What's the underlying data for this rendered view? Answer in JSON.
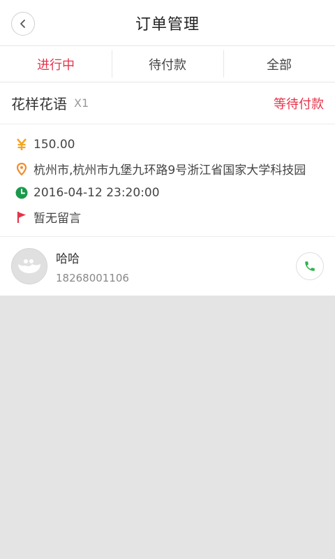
{
  "header": {
    "title": "订单管理"
  },
  "tabs": [
    {
      "label": "进行中",
      "active": true
    },
    {
      "label": "待付款",
      "active": false
    },
    {
      "label": "全部",
      "active": false
    }
  ],
  "order": {
    "product_name": "花样花语",
    "quantity": "X1",
    "status": "等待付款",
    "price": "150.00",
    "address": "杭州市,杭州市九堡九环路9号浙江省国家大学科技园",
    "datetime": "2016-04-12 23:20:00",
    "message": "暂无留言",
    "contact": {
      "name": "哈哈",
      "phone": "18268001106"
    }
  },
  "colors": {
    "accent": "#e5334a",
    "yen_icon": "#f5a623",
    "location_icon": "#f28b2c",
    "clock_icon": "#1a9a4a",
    "flag_icon": "#e5334a",
    "phone_icon": "#2bb34a",
    "background": "#e4e4e4"
  },
  "icons": [
    "back-arrow-icon",
    "yen-icon",
    "location-pin-icon",
    "clock-icon",
    "flag-icon",
    "avatar-placeholder-icon",
    "phone-icon"
  ]
}
